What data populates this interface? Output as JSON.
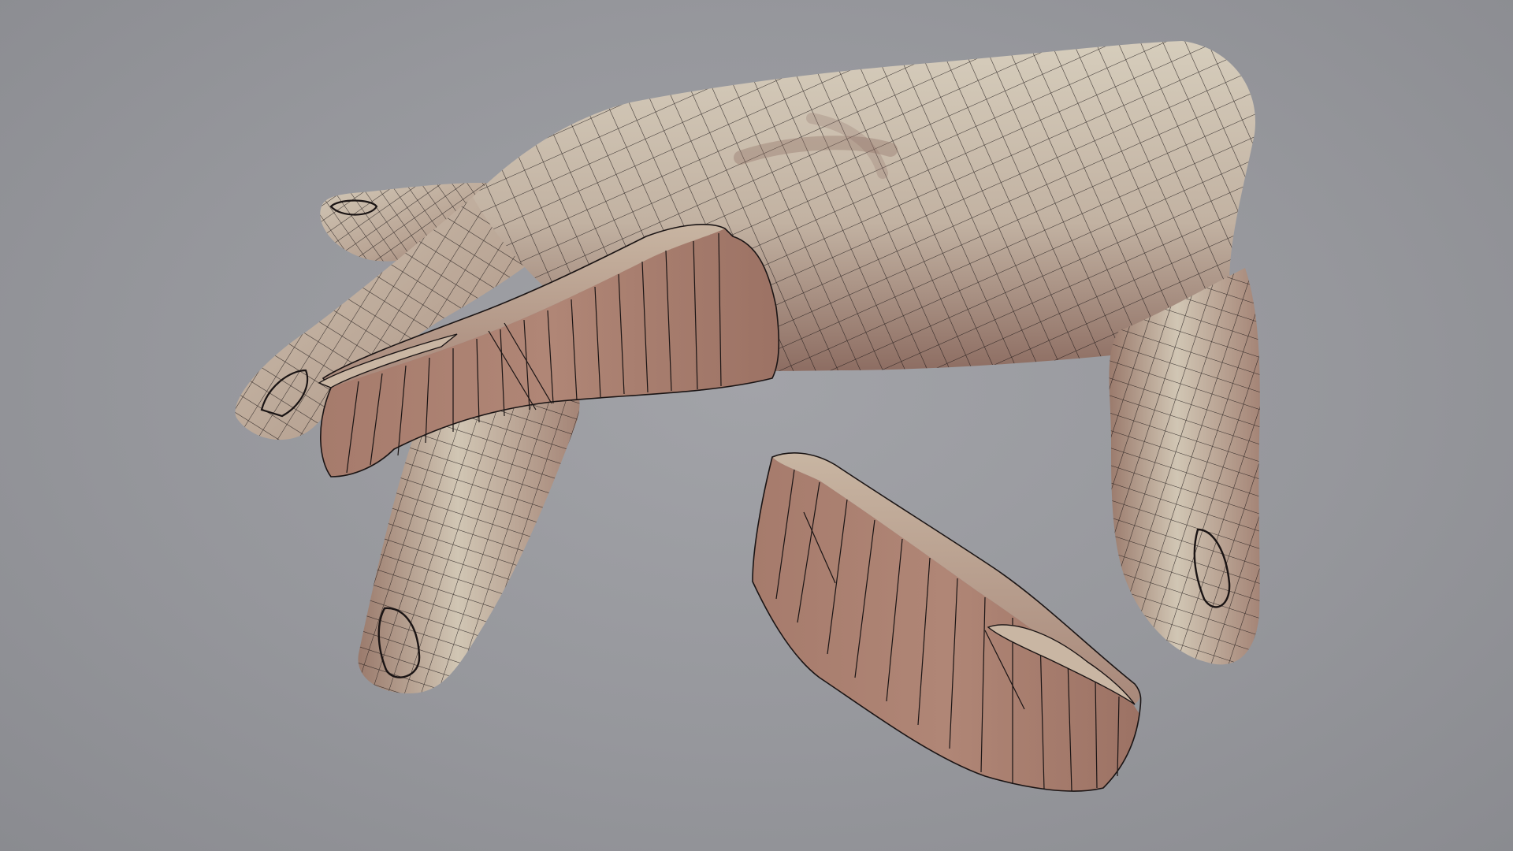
{
  "viewport": {
    "background": "#97989c",
    "shading": "smooth-shaded-wireframe-on-shaded"
  },
  "model": {
    "skin_light": "#cfc6b6",
    "skin_mid": "#b49e90",
    "skin_dark": "#8a6a60",
    "flat_face": "#a97f70",
    "flat_face_dark": "#8f685c",
    "wire_color": "#1a1414"
  }
}
